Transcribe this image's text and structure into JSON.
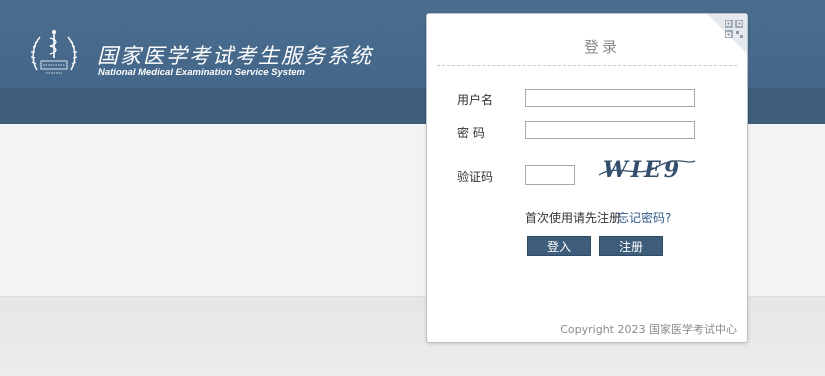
{
  "header": {
    "title_cn": "国家医学考试考生服务系统",
    "title_en": "National Medical Examination Service System",
    "logo_name": "caduceus-logo",
    "colors": {
      "band_top": "#4b6d8d",
      "band_mid": "#3e5d7b",
      "background": "#f3f3f3"
    }
  },
  "login": {
    "title": "登录",
    "username_label": "用户名",
    "username_value": "",
    "password_label": "密 码",
    "password_value": "",
    "captcha_label": "验证码",
    "captcha_value": "",
    "captcha_text": "WIE9",
    "first_use_text": "首次使用请先注册",
    "forgot_password": "忘记密码?",
    "login_button": "登入",
    "register_button": "注册",
    "copyright": "Copyright 2023 国家医学考试中心",
    "qr_icon": "qr-code-icon",
    "button_color": "#3e5d7b",
    "link_color": "#2f5b8a"
  }
}
